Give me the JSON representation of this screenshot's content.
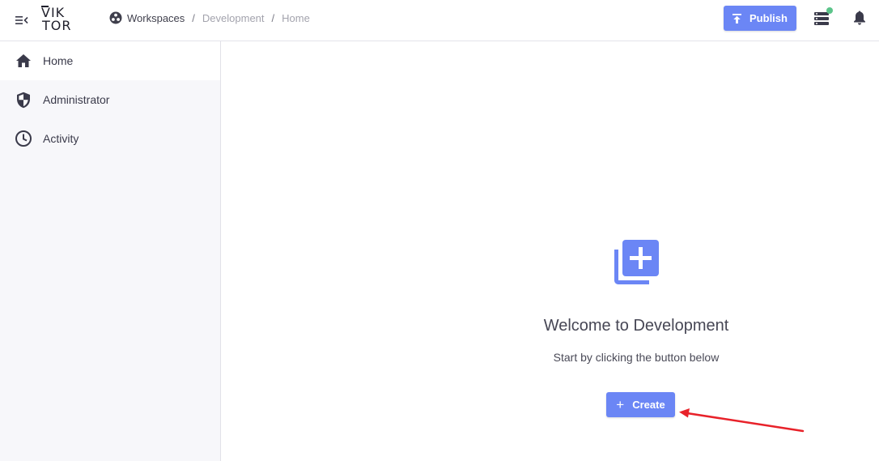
{
  "header": {
    "logo_line1": "VIK",
    "logo_line2": "TOR",
    "logo_text": "VIKTOR",
    "breadcrumb": [
      "Workspaces",
      "Development",
      "Home"
    ],
    "breadcrumb_separator": "/",
    "publish_label": "Publish",
    "icons": {
      "menu": "menu-collapse-icon",
      "workspaces": "workspaces-icon",
      "publish": "upload-icon",
      "environments": "server-stack-icon",
      "notifications": "bell-icon"
    },
    "status_color": "#5cc48a"
  },
  "sidebar": {
    "items": [
      {
        "label": "Home",
        "icon": "home-icon",
        "active": true
      },
      {
        "label": "Administrator",
        "icon": "shield-icon",
        "active": false
      },
      {
        "label": "Activity",
        "icon": "clock-icon",
        "active": false
      }
    ]
  },
  "main": {
    "icon": "add-to-library-icon",
    "title": "Welcome to Development",
    "subtitle": "Start by clicking the button below",
    "create_label": "Create"
  },
  "colors": {
    "accent": "#6b86f5",
    "sidebar_bg": "#f7f7fa",
    "annotation": "#e8222a"
  }
}
